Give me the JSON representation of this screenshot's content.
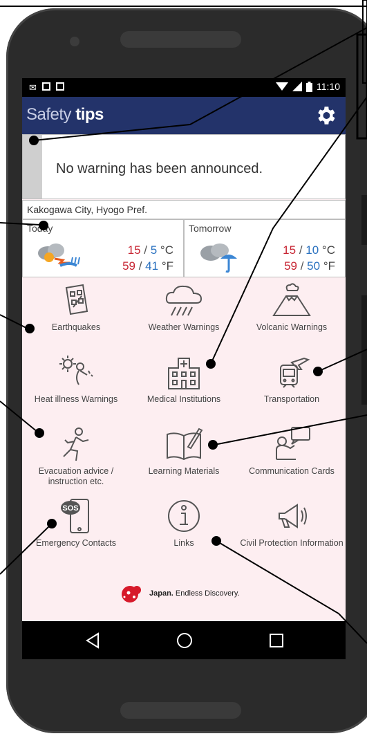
{
  "app": {
    "title_light": "Safety",
    "title_bold": "tips"
  },
  "status": {
    "time": "11:10"
  },
  "warning": {
    "text": "No warning has been announced."
  },
  "location": "Kakogawa City, Hyogo Pref.",
  "forecast": {
    "today": {
      "label": "Today",
      "hi_c": "15",
      "lo_c": "5",
      "hi_f": "59",
      "lo_f": "41"
    },
    "tomorrow": {
      "label": "Tomorrow",
      "hi_c": "15",
      "lo_c": "10",
      "hi_f": "59",
      "lo_f": "50"
    },
    "unit_c": "°C",
    "unit_f": "°F"
  },
  "menu": [
    {
      "label": "Earthquakes",
      "icon": "earthquake-icon"
    },
    {
      "label": "Weather Warnings",
      "icon": "rain-cloud-icon"
    },
    {
      "label": "Volcanic Warnings",
      "icon": "volcano-icon"
    },
    {
      "label": "Heat illness Warnings",
      "icon": "heat-illness-icon"
    },
    {
      "label": "Medical Institutions",
      "icon": "hospital-icon"
    },
    {
      "label": "Transportation",
      "icon": "transportation-icon"
    },
    {
      "label": "Evacuation advice / instruction etc.",
      "icon": "evacuation-icon"
    },
    {
      "label": "Learning Materials",
      "icon": "book-icon"
    },
    {
      "label": "Communication Cards",
      "icon": "communication-card-icon"
    },
    {
      "label": "Emergency Contacts",
      "icon": "sos-phone-icon"
    },
    {
      "label": "Links",
      "icon": "info-icon"
    },
    {
      "label": "Civil Protection Information",
      "icon": "megaphone-icon"
    }
  ],
  "sos_badge": "SOS",
  "logo_text": {
    "bold": "Japan.",
    "rest": "Endless Discovery."
  },
  "colors": {
    "appbar": "#23336a",
    "screen_bg": "#fdeef1",
    "temp_high": "#c72432",
    "temp_low": "#2b72c0"
  }
}
